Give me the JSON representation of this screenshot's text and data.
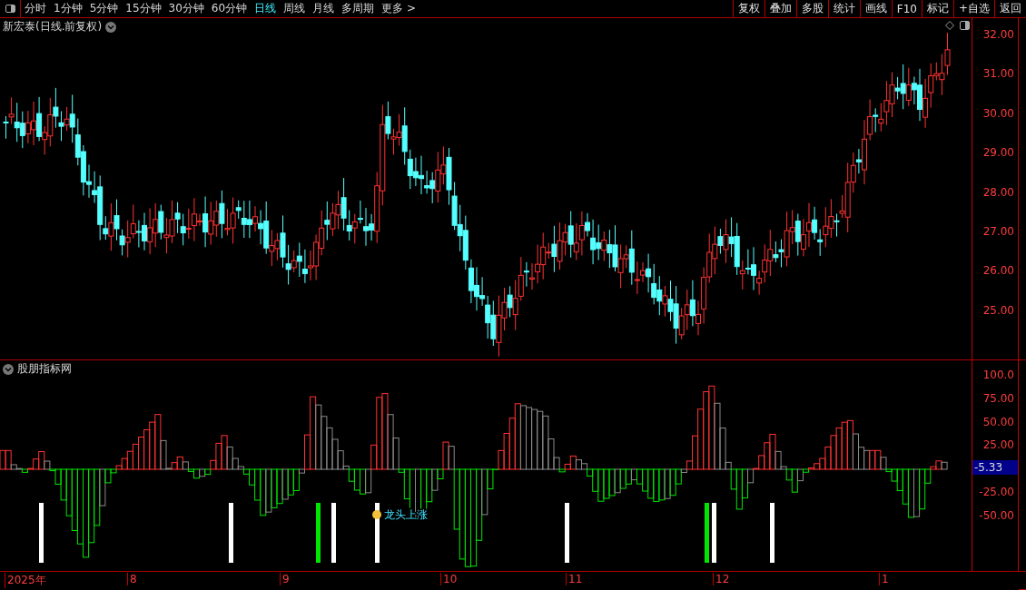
{
  "toolbar": {
    "periods": [
      {
        "label": "分时",
        "selected": false
      },
      {
        "label": "1分钟",
        "selected": false
      },
      {
        "label": "5分钟",
        "selected": false
      },
      {
        "label": "15分钟",
        "selected": false
      },
      {
        "label": "30分钟",
        "selected": false
      },
      {
        "label": "60分钟",
        "selected": false
      },
      {
        "label": "日线",
        "selected": true
      },
      {
        "label": "周线",
        "selected": false
      },
      {
        "label": "月线",
        "selected": false
      },
      {
        "label": "多周期",
        "selected": false
      },
      {
        "label": "更多 >",
        "selected": false
      }
    ],
    "actions": [
      "复权",
      "叠加",
      "多股",
      "统计",
      "画线",
      "F10",
      "标记",
      "+自选",
      "返回"
    ]
  },
  "price_chart": {
    "title": "新宏泰(日线.前复权)",
    "axis_labels": [
      "32.00",
      "31.00",
      "30.00",
      "29.00",
      "28.00",
      "27.00",
      "26.00",
      "25.00"
    ]
  },
  "indicator": {
    "title": "股朋指标网",
    "axis_labels": [
      "100.0",
      "75.00",
      "50.00",
      "25.00",
      "-25.00",
      "-50.00"
    ],
    "current_value": "-5.33",
    "annotation": "龙头上涨"
  },
  "date_axis": [
    "2025年",
    "8",
    "9",
    "10",
    "11",
    "12",
    "1"
  ]
}
